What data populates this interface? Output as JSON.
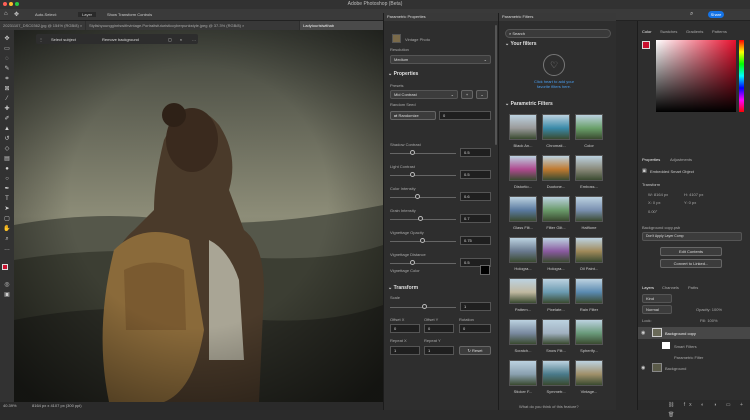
{
  "window": {
    "title": "Adobe Photoshop (Beta)",
    "share": "Share"
  },
  "options": {
    "auto_select": "Auto-Select:",
    "layer": "Layer",
    "transform": "Show Transform Controls"
  },
  "tabs": [
    "20231107_DSC0362.jpg @ 154% (RGB/8) ×",
    "Stylishyoungginrlswithvintage.Portraitsfuturisticcyberpunkstyle.jpeg @ 37.3% (RGB/8) ×",
    "Ladytouristwithab"
  ],
  "context": {
    "select_subject": "Select subject",
    "remove_bg": "Remove background"
  },
  "status": {
    "zoom": "40.39%",
    "doc": "8164 px x 4107 px (300 ppi)"
  },
  "parametric_properties": {
    "header": "Parametric Properties",
    "filter_name": "Vintage Photo",
    "resolution_label": "Resolution",
    "resolution_value": "Medium",
    "properties_label": "Properties",
    "presets_label": "Presets",
    "preset_value": "Mid Contrast",
    "random_seed_label": "Random Seed",
    "randomize": "Randomize",
    "seed_value": "0",
    "sliders": [
      {
        "label": "Shadow Contrast",
        "value": "0.5",
        "pos": 0.3
      },
      {
        "label": "Light Contrast",
        "value": "0.5",
        "pos": 0.3
      },
      {
        "label": "Color Intensity",
        "value": "0.6",
        "pos": 0.38
      },
      {
        "label": "Grain Intensity",
        "value": "0.7",
        "pos": 0.43
      },
      {
        "label": "Vignettage Opacity",
        "value": "0.75",
        "pos": 0.46
      },
      {
        "label": "Vignettage Distance",
        "value": "0.5",
        "pos": 0.3
      }
    ],
    "vignettage_color_label": "Vignettage Color",
    "transform_label": "Transform",
    "scale_label": "Scale",
    "scale_value": "1",
    "offset_x_label": "Offset X",
    "offset_y_label": "Offset Y",
    "rotation_label": "Rotation",
    "offset_x": "0",
    "offset_y": "0",
    "rotation": "0",
    "repeat_x_label": "Repeat X",
    "repeat_y_label": "Repeat Y",
    "repeat_x": "1",
    "repeat_y": "1",
    "reset": "Reset"
  },
  "parametric_filters": {
    "header": "Parametric Filters",
    "search_placeholder": "Search",
    "your_filters": "Your filters",
    "empty_text": "Click heart to add your favorite filters here.",
    "section": "Parametric Filters",
    "items": [
      {
        "label": "Black An...",
        "color": "#9a9a9a"
      },
      {
        "label": "Chromati...",
        "color": "#3a8aa8"
      },
      {
        "label": "Color",
        "color": "#6aa06a"
      },
      {
        "label": "Distortio...",
        "color": "#b04a90"
      },
      {
        "label": "Duotone...",
        "color": "#c07a30"
      },
      {
        "label": "Emboss...",
        "color": "#8a8a7a"
      },
      {
        "label": "Glass Filt...",
        "color": "#5a7aa0"
      },
      {
        "label": "Filter Glit...",
        "color": "#6a9a6a"
      },
      {
        "label": "Halftone",
        "color": "#7a90b0"
      },
      {
        "label": "Hologra...",
        "color": "#6a7a90"
      },
      {
        "label": "Hologra...",
        "color": "#8a5aa0"
      },
      {
        "label": "Oil Paint...",
        "color": "#a08a5a"
      },
      {
        "label": "Pattern...",
        "color": "#c0b8a0"
      },
      {
        "label": "Pixelate...",
        "color": "#6a9ab0"
      },
      {
        "label": "Rain Filter",
        "color": "#5a8ab0"
      },
      {
        "label": "Scratch...",
        "color": "#7a8aa0"
      },
      {
        "label": "Snow Filt...",
        "color": "#a0b0c0"
      },
      {
        "label": "Spherify...",
        "color": "#6a9a7a"
      },
      {
        "label": "Sticker F...",
        "color": "#8aa0b0"
      },
      {
        "label": "Symmetr...",
        "color": "#4a7a8a"
      },
      {
        "label": "Vintage...",
        "color": "#a0906a"
      }
    ],
    "feedback": "What do you think of this feature?"
  },
  "right_panels": {
    "color_tabs": [
      "Color",
      "Swatches",
      "Gradients",
      "Patterns"
    ],
    "props_tabs": [
      "Properties",
      "Adjustments"
    ],
    "smart_object": "Embedded Smart Object",
    "transform": "Transform",
    "w": "W: 8164 px",
    "h": "H: 4107 px",
    "x": "X: 0 px",
    "y": "Y: 0 px",
    "angle": "0.00°",
    "layer_comp": "Background copy.psb",
    "layer_comp_placeholder": "Don't Apply Layer Comp",
    "edit_contents": "Edit Contents",
    "convert_linked": "Convert to Linked...",
    "layers_tabs": [
      "Layers",
      "Channels",
      "Paths"
    ],
    "kind": "Kind",
    "blend": "Normal",
    "opacity": "Opacity: 100%",
    "lock": "Lock:",
    "fill": "Fill: 100%",
    "layers": [
      "Background copy",
      "Smart Filters",
      "Parametric Filter",
      "Background"
    ]
  },
  "colors": {
    "accent": "#1473e6",
    "panel": "#2e2e2e",
    "fg": "#c8102e"
  }
}
